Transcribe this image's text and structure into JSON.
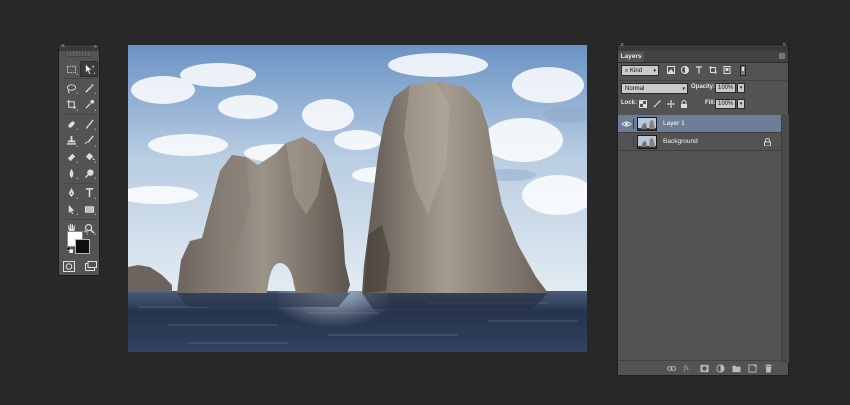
{
  "tools_panel": {
    "close_glyph": "×",
    "collapse_glyph": "»",
    "tools": [
      [
        "rect-marquee-icon",
        "move-icon"
      ],
      [
        "lasso-icon",
        "magic-wand-icon"
      ],
      [
        "crop-icon",
        "eyedropper-icon"
      ],
      [
        "healing-brush-icon",
        "brush-icon"
      ],
      [
        "clone-stamp-icon",
        "history-brush-icon"
      ],
      [
        "eraser-icon",
        "paint-bucket-icon"
      ],
      [
        "blur-icon",
        "dodge-icon"
      ],
      [
        "pen-icon",
        "type-icon"
      ],
      [
        "path-select-icon",
        "rectangle-shape-icon"
      ],
      [
        "hand-icon",
        "zoom-icon"
      ]
    ],
    "foreground_color": "#ffffff",
    "background_color": "#0f0f0f",
    "swap_glyph": "↰"
  },
  "layers_panel": {
    "close_glyph": "×",
    "collapse_glyph": "»",
    "tab_label": "Layers",
    "filter_kind": "Kind",
    "blend_mode": "Normal",
    "opacity_label": "Opacity:",
    "opacity_value": "100%",
    "lock_label": "Lock:",
    "fill_label": "Fill:",
    "fill_value": "100%",
    "caret": "▾",
    "layers": [
      {
        "name": "Layer 1",
        "selected": true,
        "visible": true
      },
      {
        "name": "Background",
        "selected": false,
        "visible": false,
        "locked": true
      }
    ],
    "footer_fx": "fx."
  },
  "colors": {
    "workspace": "#282828",
    "panel": "#535353",
    "selection": "#6d7d95"
  }
}
